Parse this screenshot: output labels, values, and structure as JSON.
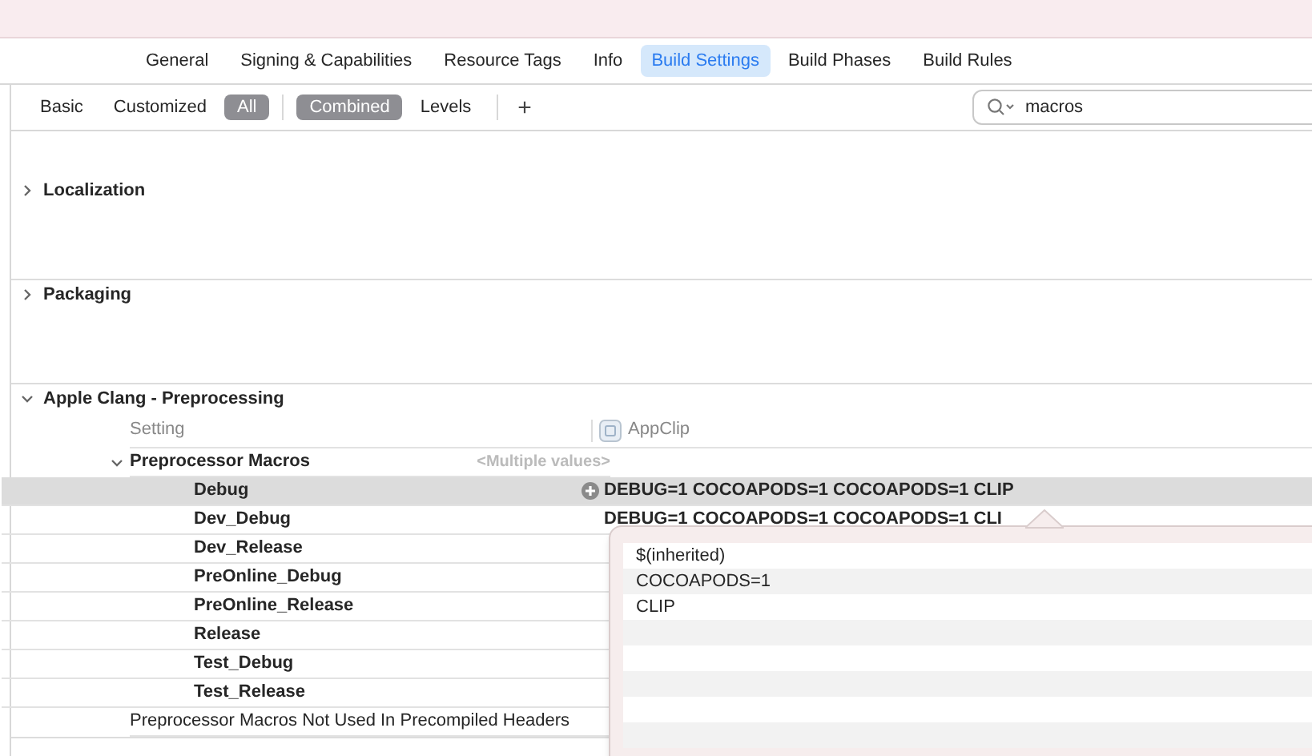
{
  "tabs": [
    {
      "label": "General",
      "selected": false
    },
    {
      "label": "Signing & Capabilities",
      "selected": false
    },
    {
      "label": "Resource Tags",
      "selected": false
    },
    {
      "label": "Info",
      "selected": false
    },
    {
      "label": "Build Settings",
      "selected": true
    },
    {
      "label": "Build Phases",
      "selected": false
    },
    {
      "label": "Build Rules",
      "selected": false
    }
  ],
  "filter_groups": [
    {
      "items": [
        {
          "label": "Basic",
          "selected": false
        },
        {
          "label": "Customized",
          "selected": false
        },
        {
          "label": "All",
          "selected": true
        }
      ]
    },
    {
      "items": [
        {
          "label": "Combined",
          "selected": true
        },
        {
          "label": "Levels",
          "selected": false
        }
      ]
    }
  ],
  "add_button": "+",
  "search": {
    "value": "macros"
  },
  "sections": [
    {
      "title": "Localization",
      "expanded": false
    },
    {
      "title": "Packaging",
      "expanded": false
    },
    {
      "title": "Apple Clang - Preprocessing",
      "expanded": true,
      "header": {
        "setting": "Setting",
        "target": "AppClip"
      },
      "settings": [
        {
          "name": "Preprocessor Macros",
          "value": "<Multiple values>",
          "expanded": true,
          "children": [
            {
              "name": "Debug",
              "value": "DEBUG=1  COCOAPODS=1 COCOAPODS=1 CLIP",
              "selected": true
            },
            {
              "name": "Dev_Debug",
              "value": "DEBUG=1  COCOAPODS=1 COCOAPODS=1 CLI",
              "selected": false
            },
            {
              "name": "Dev_Release",
              "selected": false
            },
            {
              "name": "PreOnline_Debug",
              "selected": false
            },
            {
              "name": "PreOnline_Release",
              "selected": false
            },
            {
              "name": "Release",
              "selected": false
            },
            {
              "name": "Test_Debug",
              "selected": false
            },
            {
              "name": "Test_Release",
              "selected": false
            }
          ]
        },
        {
          "name": "Preprocessor Macros Not Used In Precompiled Headers"
        }
      ]
    }
  ],
  "popover": {
    "items": [
      "$(inherited)",
      "COCOAPODS=1",
      "CLIP"
    ]
  }
}
